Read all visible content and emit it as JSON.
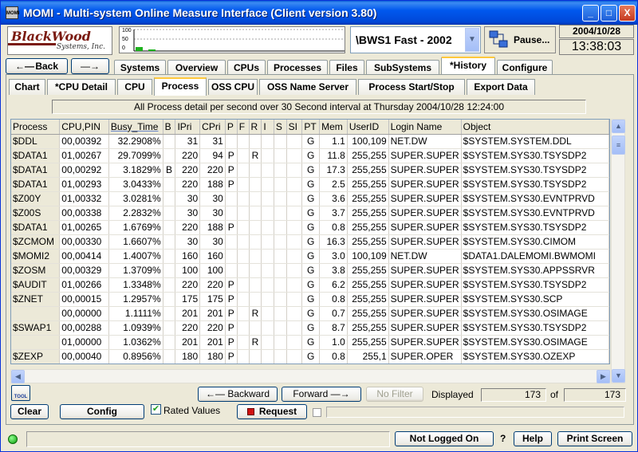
{
  "window": {
    "title": "MOMI - Multi-system Online Measure Interface (Client version 3.80)",
    "icon_label": "MOMI",
    "minimize": "_",
    "maximize": "□",
    "close": "X"
  },
  "header": {
    "back_label": "Back",
    "logo_line1": "BlackWood",
    "logo_line2": "Systems, Inc.",
    "mini_chart_axis_top": "100",
    "mini_chart_axis_mid": "50",
    "mini_chart_axis_bottom": "0",
    "system_selected": "\\BWS1 Fast - 2002",
    "pause_label": "Pause...",
    "date": "2004/10/28",
    "time": "13:38:03"
  },
  "main_tabs": [
    "Systems",
    "Overview",
    "CPUs",
    "Processes",
    "Files",
    "SubSystems",
    "*History",
    "Configure"
  ],
  "main_tab_active": "*History",
  "sub_tabs": [
    "Chart",
    "*CPU Detail",
    "CPU",
    "Process",
    "OSS CPU",
    "OSS Name Server",
    "Process Start/Stop",
    "Export Data"
  ],
  "sub_tab_active": "Process",
  "banner": "All Process detail per second over 30 Second interval at Thursday 2004/10/28 12:24:00",
  "table": {
    "columns": [
      "Process",
      "CPU,PIN",
      "Busy_Time",
      "B",
      "IPri",
      "CPri",
      "P",
      "F",
      "R",
      "I",
      "S",
      "SI",
      "PT",
      "Mem",
      "UserID",
      "Login Name",
      "Object"
    ],
    "sorted_column": "Busy_Time",
    "rows": [
      [
        "$DDL",
        "00,00392",
        "32.2908%",
        "",
        "31",
        "31",
        "",
        "",
        "",
        "",
        "",
        "",
        "G",
        "1.1",
        "100,109",
        "NET.DW",
        "$SYSTEM.SYSTEM.DDL"
      ],
      [
        "$DATA1",
        "01,00267",
        "29.7099%",
        "",
        "220",
        "94",
        "P",
        "",
        "R",
        "",
        "",
        "",
        "G",
        "11.8",
        "255,255",
        "SUPER.SUPER",
        "$SYSTEM.SYS30.TSYSDP2"
      ],
      [
        "$DATA1",
        "00,00292",
        "3.1829%",
        "B",
        "220",
        "220",
        "P",
        "",
        "",
        "",
        "",
        "",
        "G",
        "17.3",
        "255,255",
        "SUPER.SUPER",
        "$SYSTEM.SYS30.TSYSDP2"
      ],
      [
        "$DATA1",
        "01,00293",
        "3.0433%",
        "",
        "220",
        "188",
        "P",
        "",
        "",
        "",
        "",
        "",
        "G",
        "2.5",
        "255,255",
        "SUPER.SUPER",
        "$SYSTEM.SYS30.TSYSDP2"
      ],
      [
        "$Z00Y",
        "01,00332",
        "3.0281%",
        "",
        "30",
        "30",
        "",
        "",
        "",
        "",
        "",
        "",
        "G",
        "3.6",
        "255,255",
        "SUPER.SUPER",
        "$SYSTEM.SYS30.EVNTPRVD"
      ],
      [
        "$Z00S",
        "00,00338",
        "2.2832%",
        "",
        "30",
        "30",
        "",
        "",
        "",
        "",
        "",
        "",
        "G",
        "3.7",
        "255,255",
        "SUPER.SUPER",
        "$SYSTEM.SYS30.EVNTPRVD"
      ],
      [
        "$DATA1",
        "01,00265",
        "1.6769%",
        "",
        "220",
        "188",
        "P",
        "",
        "",
        "",
        "",
        "",
        "G",
        "0.8",
        "255,255",
        "SUPER.SUPER",
        "$SYSTEM.SYS30.TSYSDP2"
      ],
      [
        "$ZCMOM",
        "00,00330",
        "1.6607%",
        "",
        "30",
        "30",
        "",
        "",
        "",
        "",
        "",
        "",
        "G",
        "16.3",
        "255,255",
        "SUPER.SUPER",
        "$SYSTEM.SYS30.CIMOM"
      ],
      [
        "$MOMI2",
        "00,00414",
        "1.4007%",
        "",
        "160",
        "160",
        "",
        "",
        "",
        "",
        "",
        "",
        "G",
        "3.0",
        "100,109",
        "NET.DW",
        "$DATA1.DALEMOMI.BWMOMI"
      ],
      [
        "$ZOSM",
        "00,00329",
        "1.3709%",
        "",
        "100",
        "100",
        "",
        "",
        "",
        "",
        "",
        "",
        "G",
        "3.8",
        "255,255",
        "SUPER.SUPER",
        "$SYSTEM.SYS30.APPSSRVR"
      ],
      [
        "$AUDIT",
        "01,00266",
        "1.3348%",
        "",
        "220",
        "220",
        "P",
        "",
        "",
        "",
        "",
        "",
        "G",
        "6.2",
        "255,255",
        "SUPER.SUPER",
        "$SYSTEM.SYS30.TSYSDP2"
      ],
      [
        "$ZNET",
        "00,00015",
        "1.2957%",
        "",
        "175",
        "175",
        "P",
        "",
        "",
        "",
        "",
        "",
        "G",
        "0.8",
        "255,255",
        "SUPER.SUPER",
        "$SYSTEM.SYS30.SCP"
      ],
      [
        "",
        "00,00000",
        "1.1111%",
        "",
        "201",
        "201",
        "P",
        "",
        "R",
        "",
        "",
        "",
        "G",
        "0.7",
        "255,255",
        "SUPER.SUPER",
        "$SYSTEM.SYS30.OSIMAGE"
      ],
      [
        "$SWAP1",
        "00,00288",
        "1.0939%",
        "",
        "220",
        "220",
        "P",
        "",
        "",
        "",
        "",
        "",
        "G",
        "8.7",
        "255,255",
        "SUPER.SUPER",
        "$SYSTEM.SYS30.TSYSDP2"
      ],
      [
        "",
        "01,00000",
        "1.0362%",
        "",
        "201",
        "201",
        "P",
        "",
        "R",
        "",
        "",
        "",
        "G",
        "1.0",
        "255,255",
        "SUPER.SUPER",
        "$SYSTEM.SYS30.OSIMAGE"
      ],
      [
        "$ZEXP",
        "00,00040",
        "0.8956%",
        "",
        "180",
        "180",
        "P",
        "",
        "",
        "",
        "",
        "",
        "G",
        "0.8",
        "255,1",
        "SUPER.OPER",
        "$SYSTEM.SYS30.OZEXP"
      ]
    ]
  },
  "bottom": {
    "tool_label": "TOOL",
    "backward_label": "Backward",
    "forward_label": "Forward",
    "no_filter_label": "No Filter",
    "displayed_label": "Displayed",
    "displayed_count": "173",
    "of_label": "of",
    "total_count": "173",
    "clear_label": "Clear",
    "config_label": "Config",
    "rated_values_label": "Rated Values",
    "rated_values_checked": true,
    "request_label": "Request"
  },
  "statusbar": {
    "not_logged_on_label": "Not Logged On",
    "question_mark": "?",
    "help_label": "Help",
    "print_screen_label": "Print Screen"
  },
  "colors": {
    "title_bar": "#0054E3",
    "active_tab_highlight": "#FFC83C",
    "status_led": "#0A9A0A"
  }
}
